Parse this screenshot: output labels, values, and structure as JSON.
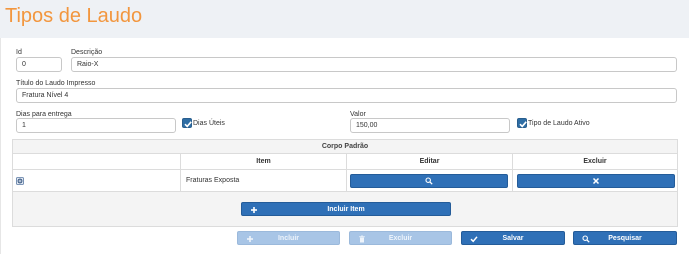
{
  "page_title": "Tipos de Laudo",
  "form": {
    "id": {
      "label": "Id",
      "value": "0"
    },
    "descricao": {
      "label": "Descrição",
      "value": "Raio-X"
    },
    "titulo_laudo": {
      "label": "Título do Laudo Impresso",
      "value": "Fratura Nível 4"
    },
    "dias_entrega": {
      "label": "Dias para entrega",
      "value": "1"
    },
    "dias_uteis": {
      "label": "Dias Úteis",
      "checked": true
    },
    "valor": {
      "label": "Valor",
      "value": "150,00"
    },
    "tipo_ativo": {
      "label": "Tipo de Laudo Ativo",
      "checked": true
    }
  },
  "grid": {
    "caption": "Corpo Padrão",
    "columns": [
      "",
      "Item",
      "Editar",
      "Excluir"
    ],
    "rows": [
      {
        "item": "Fraturas Exposta",
        "row_icon": "gear-icon",
        "edit_icon": "search-icon",
        "delete_icon": "close-icon"
      }
    ],
    "add_button": "Incluir Item"
  },
  "actions": {
    "incluir": {
      "label": "Incluir",
      "enabled": false
    },
    "excluir": {
      "label": "Excluir",
      "enabled": false
    },
    "salvar": {
      "label": "Salvar",
      "enabled": true
    },
    "pesquisar": {
      "label": "Pesquisar",
      "enabled": true
    }
  },
  "colors": {
    "accent_title": "#f2963e",
    "primary_button": "#2f70b7",
    "disabled_button": "#a8c5e6"
  }
}
